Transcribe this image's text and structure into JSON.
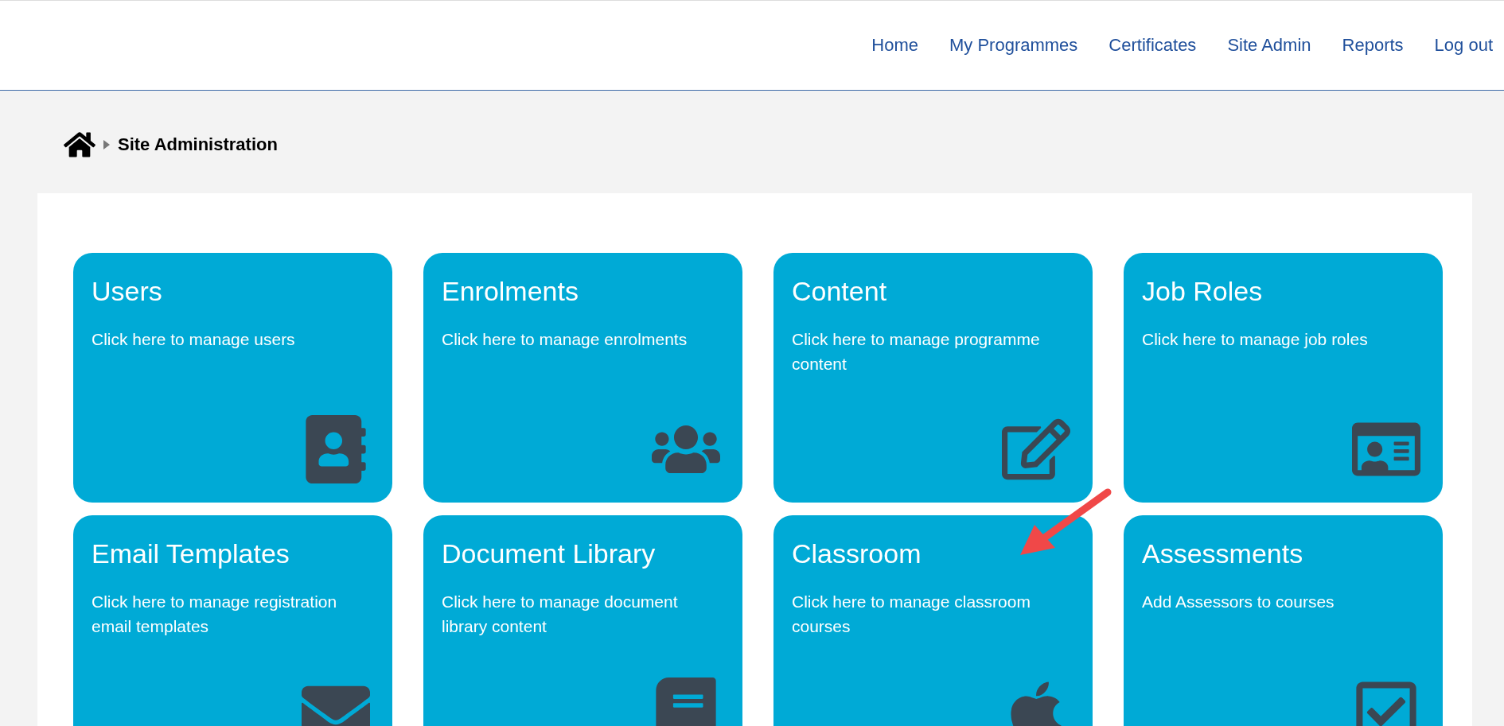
{
  "nav": [
    {
      "label": "Home"
    },
    {
      "label": "My Programmes"
    },
    {
      "label": "Certificates"
    },
    {
      "label": "Site Admin"
    },
    {
      "label": "Reports"
    },
    {
      "label": "Log out"
    }
  ],
  "breadcrumb": {
    "current": "Site Administration"
  },
  "tiles": [
    {
      "title": "Users",
      "description": "Click here to manage users"
    },
    {
      "title": "Enrolments",
      "description": "Click here to manage enrolments"
    },
    {
      "title": "Content",
      "description": "Click here to manage programme content"
    },
    {
      "title": "Job Roles",
      "description": "Click here to manage job roles"
    },
    {
      "title": "Email Templates",
      "description": "Click here to manage registration email templates"
    },
    {
      "title": "Document Library",
      "description": "Click here to manage document library content"
    },
    {
      "title": "Classroom",
      "description": "Click here to manage classroom courses"
    },
    {
      "title": "Assessments",
      "description": "Add Assessors to courses"
    }
  ]
}
